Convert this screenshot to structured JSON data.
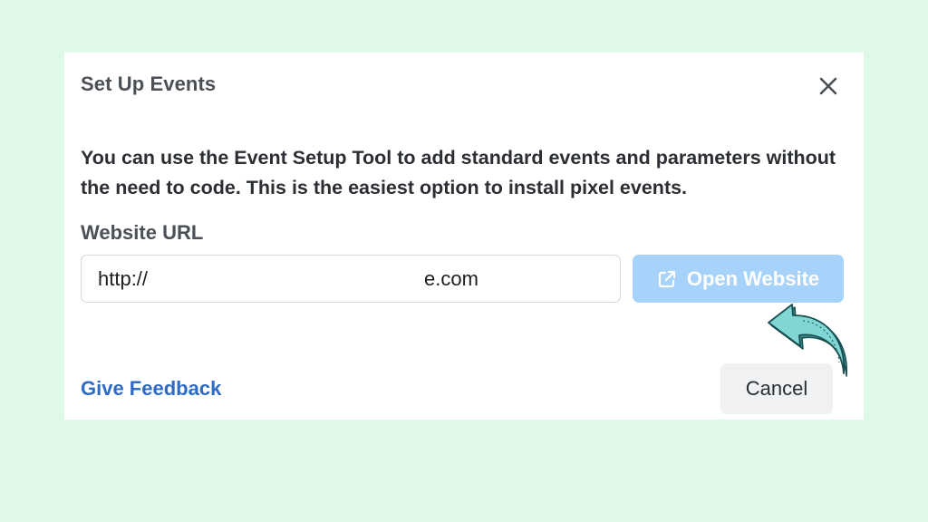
{
  "dialog": {
    "title": "Set Up Events",
    "close_icon": "close-icon",
    "description": "You can use the Event Setup Tool to add standard events and parameters without the need to code. This is the easiest option to install pixel events.",
    "website_url": {
      "label": "Website URL",
      "value_prefix": "http://",
      "value_suffix": "e.com"
    },
    "open_website_button": {
      "label": "Open Website",
      "icon": "external-link-icon"
    },
    "give_feedback_link": "Give Feedback",
    "cancel_button": "Cancel"
  },
  "annotation": {
    "icon": "curved-arrow-icon",
    "fill_color": "#7fd6d3",
    "stroke_color": "#1a4f52"
  },
  "colors": {
    "background": "#dff8e8",
    "dialog_background": "#ffffff",
    "primary_button_disabled": "#a7d3fb",
    "link": "#2e6bc4",
    "cancel_background": "#f0f1f3"
  }
}
